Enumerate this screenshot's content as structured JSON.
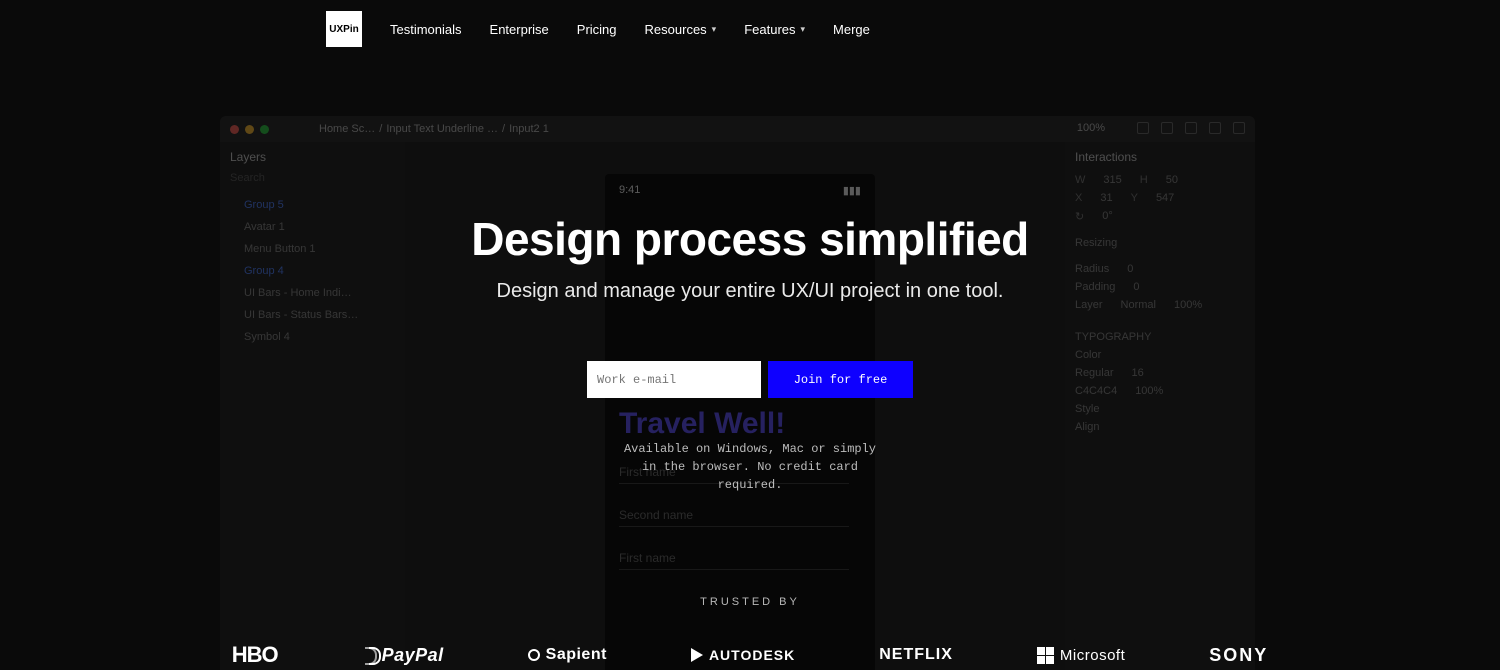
{
  "nav": {
    "logo": "UXPin",
    "items": [
      "Testimonials",
      "Enterprise",
      "Pricing",
      "Resources",
      "Features",
      "Merge"
    ],
    "dropdowns": [
      3,
      4
    ]
  },
  "tool": {
    "crumbs": [
      "Home Sc…",
      "Input Text Underline …",
      "Input2 1"
    ],
    "zoom": "100%",
    "layers_title": "Layers",
    "search_placeholder": "Search",
    "layers": [
      "Group 5",
      "Avatar 1",
      "Menu Button 1",
      "Group 4",
      "UI Bars - Home Indi…",
      "UI Bars - Status Bars…",
      "Symbol 4"
    ],
    "layer_selected": [
      0,
      3
    ],
    "right_title": "Interactions",
    "props": {
      "W": "315",
      "H": "50",
      "X": "31",
      "Y": "547",
      "R": "0°",
      "resizing": "Resizing",
      "radius_label": "Radius",
      "radius": "0",
      "padding_label": "Padding",
      "padding": "0",
      "layer_label": "Layer",
      "layer_mode": "Normal",
      "layer_pct": "100%",
      "typography": "TYPOGRAPHY",
      "color_label": "Color",
      "regular_label": "Regular",
      "regular_val": "16",
      "hex": "C4C4C4",
      "hex_pct": "100%",
      "style_label": "Style",
      "align_label": "Align"
    },
    "phone": {
      "time": "9:41",
      "title": "Travel Well!",
      "field1": "First name",
      "field2": "Second name",
      "field3": "First name"
    }
  },
  "hero": {
    "headline": "Design process simplified",
    "sub": "Design and manage your entire UX/UI project in one tool.",
    "email_placeholder": "Work e-mail",
    "cta": "Join for free",
    "availability": "Available on Windows, Mac or simply in the browser. No credit card required.",
    "trusted": "TRUSTED BY",
    "brands": [
      "HBO",
      "PayPal",
      "Sapient",
      "AUTODESK",
      "NETFLIX",
      "Microsoft",
      "SONY"
    ]
  }
}
